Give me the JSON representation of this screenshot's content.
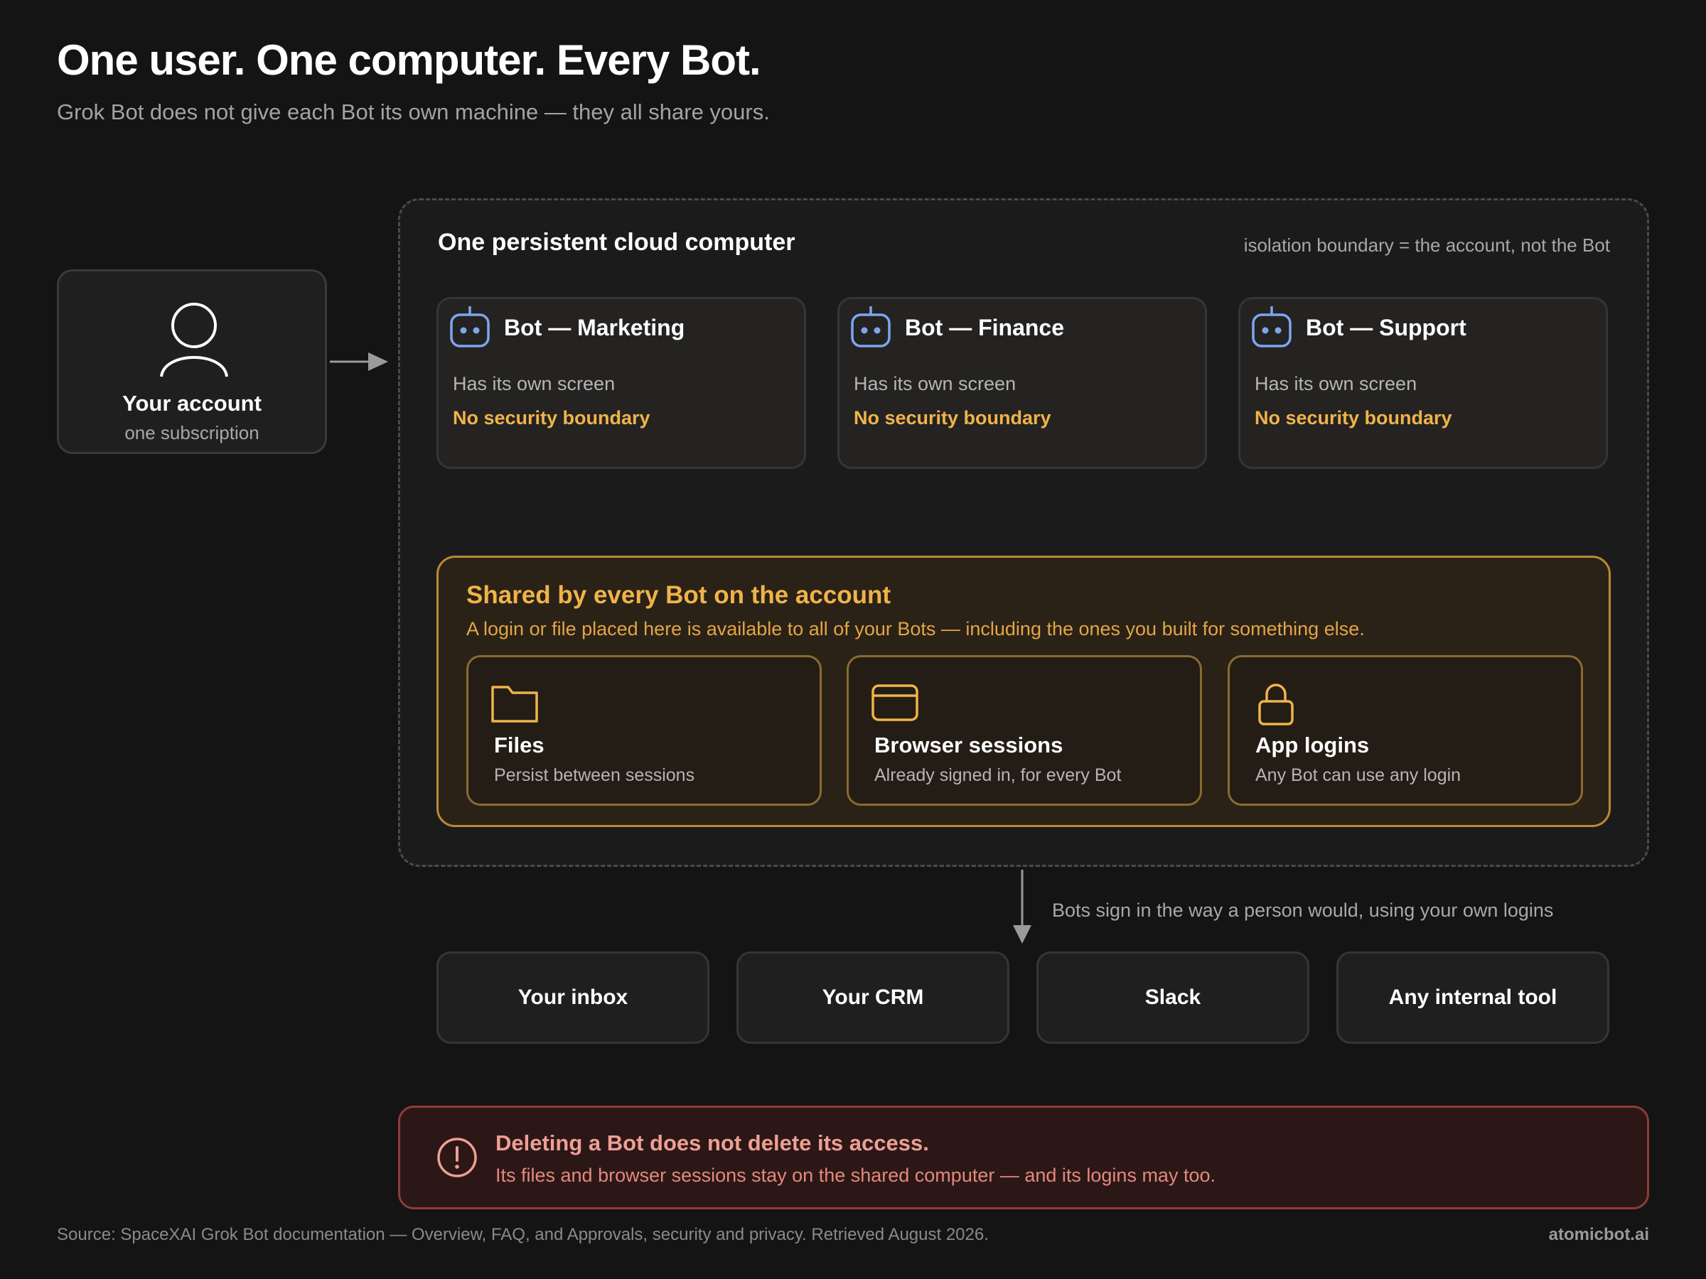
{
  "header": {
    "title": "One user. One computer. Every Bot.",
    "subtitle": "Grok Bot does not give each Bot its own machine — they all share yours."
  },
  "account": {
    "name": "Your account",
    "subscription": "one subscription",
    "icon": "user-icon"
  },
  "computer": {
    "title": "One persistent cloud computer",
    "note": "isolation boundary = the account, not the Bot",
    "bots": [
      {
        "name": "Bot — Marketing",
        "screen": "Has its own screen",
        "security": "No security boundary"
      },
      {
        "name": "Bot — Finance",
        "screen": "Has its own screen",
        "security": "No security boundary"
      },
      {
        "name": "Bot — Support",
        "screen": "Has its own screen",
        "security": "No security boundary"
      }
    ]
  },
  "shared": {
    "title": "Shared by every Bot on the account",
    "description": "A login or file placed here is available to all of your Bots — including the ones you built for something else.",
    "resources": [
      {
        "name": "Files",
        "description": "Persist between sessions",
        "icon": "folder-icon"
      },
      {
        "name": "Browser sessions",
        "description": "Already signed in, for every Bot",
        "icon": "browser-window-icon"
      },
      {
        "name": "App logins",
        "description": "Any Bot can use any login",
        "icon": "lock-icon"
      }
    ]
  },
  "signin_note": "Bots sign in the way a person would, using your own logins",
  "tools": [
    "Your inbox",
    "Your CRM",
    "Slack",
    "Any internal tool"
  ],
  "warning": {
    "title": "Deleting a Bot does not delete its access.",
    "description": "Its files and browser sessions stay on the shared computer — and its logins may too.",
    "icon": "alert-circle-icon"
  },
  "footer": {
    "source": "Source: SpaceXAI Grok Bot documentation — Overview, FAQ, and Approvals, security and privacy. Retrieved August 2026.",
    "brand": "atomicbot.ai"
  },
  "colors": {
    "background": "#141414",
    "accent_amber": "#f0b34a",
    "bot_icon_blue": "#7ea6f0",
    "warning_red": "#ee9f94"
  }
}
